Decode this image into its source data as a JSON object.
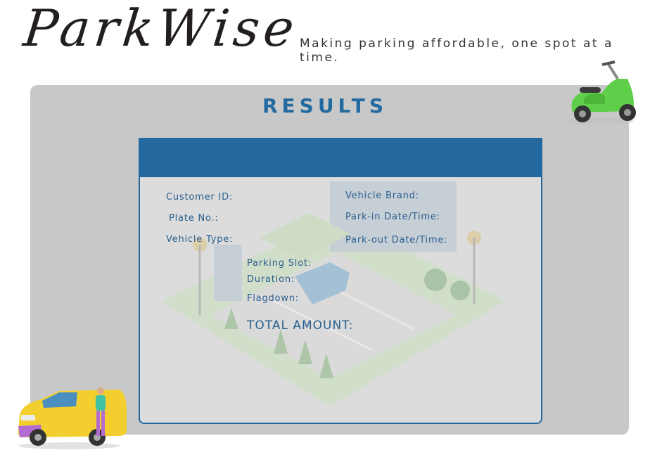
{
  "header": {
    "logo_text": "ParkWise",
    "tagline": "Making parking affordable, one spot at a time."
  },
  "results": {
    "title": "RESULTS",
    "labels": {
      "customer_id": "Customer ID:",
      "plate_no": "Plate No.:",
      "vehicle_type": "Vehicle Type:",
      "vehicle_brand": "Vehicle Brand:",
      "park_in": "Park-in Date/Time:",
      "park_out": "Park-out Date/Time:",
      "parking_slot": "Parking Slot:",
      "duration": "Duration:",
      "flagdown": "Flagdown:",
      "total_amount": "TOTAL AMOUNT:"
    }
  },
  "colors": {
    "accent": "#236aa0",
    "panel": "#c8c8c8",
    "card_header": "#2468a0"
  },
  "icons": {
    "scooter": "scooter-illustration",
    "van": "van-with-person-illustration",
    "background": "parking-lot-illustration"
  }
}
